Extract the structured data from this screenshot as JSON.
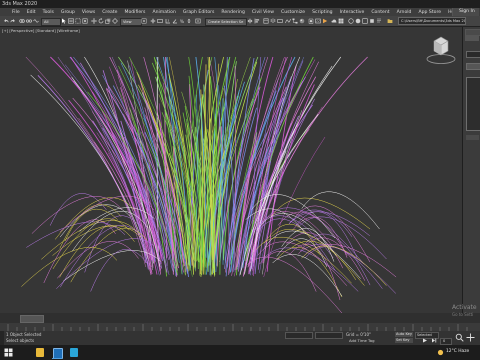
{
  "window": {
    "title": "3ds Max 2020"
  },
  "menu": [
    "File",
    "Edit",
    "Tools",
    "Group",
    "Views",
    "Create",
    "Modifiers",
    "Animation",
    "Graph Editors",
    "Rendering",
    "Civil View",
    "Customize",
    "Scripting",
    "Interactive",
    "Content",
    "Arnold",
    "App Store",
    "Help"
  ],
  "signin": {
    "label": "Sign In"
  },
  "toolbar": {
    "filter_value": "All",
    "view_value": "View",
    "selection_set": "Create Selection Se",
    "path": "C:\\Users\\BH\\Documents\\3ds Max 2020"
  },
  "viewport": {
    "label": "[+] [Perspective] [Standard] [Wireframe]"
  },
  "statusbar": {
    "selection": "1 Object Selected",
    "prompt": "Select objects",
    "grid": "Grid = 0'10\"",
    "add_time_tag": "Add Time Tag",
    "frame": "0",
    "set_key": "Set Key",
    "key_filters": "Key Filters...",
    "auto_key": "Auto Key",
    "selected": "Selected"
  },
  "watermark": {
    "line1": "Activate",
    "line2": "Go to Setti"
  },
  "taskbar": {
    "weather": "12°C Haze",
    "time": ""
  },
  "colors": {
    "accent": "#4f9fe0",
    "viewport_bg": "#363636"
  }
}
